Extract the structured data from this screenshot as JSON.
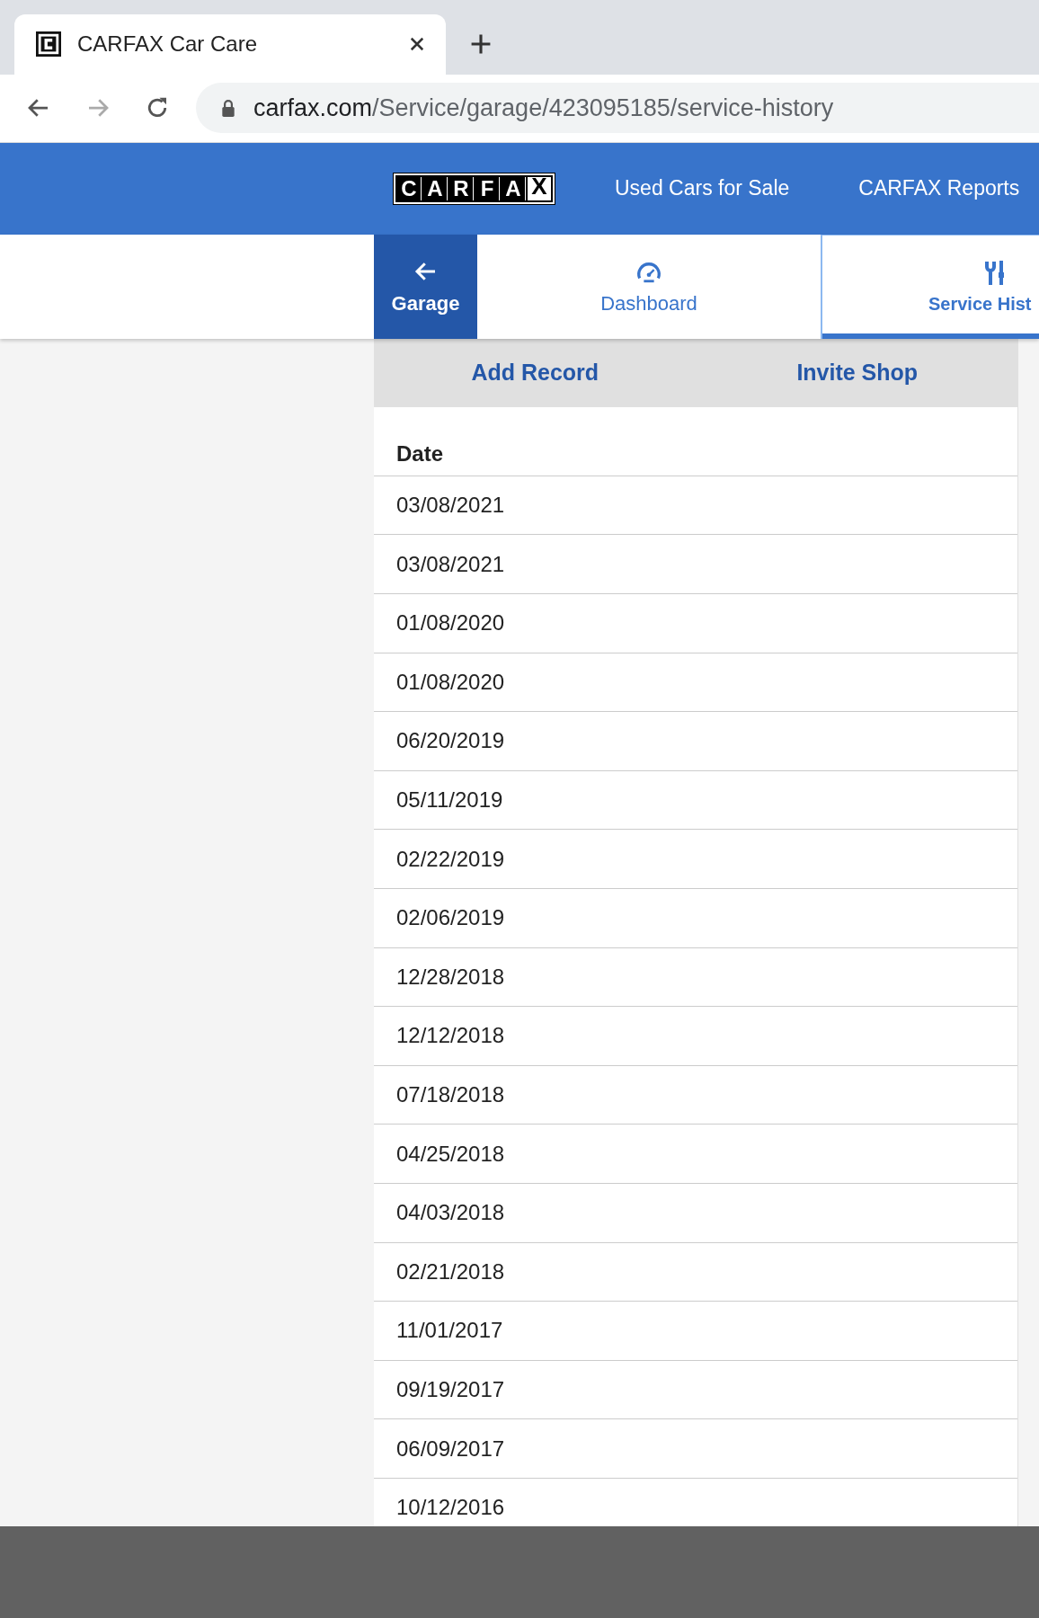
{
  "browser": {
    "tab_title": "CARFAX Car Care",
    "url_host": "carfax.com",
    "url_path": "/Service/garage/423095185/service-history"
  },
  "header": {
    "logo_letters": [
      "C",
      "A",
      "R",
      "F",
      "A",
      "X"
    ],
    "links": [
      "Used Cars for Sale",
      "CARFAX Reports"
    ]
  },
  "nav": [
    {
      "kind": "back",
      "label": "Garage",
      "selected": false
    },
    {
      "kind": "dashboard",
      "label": "Dashboard",
      "selected": false
    },
    {
      "kind": "service",
      "label": "Service Hist",
      "selected": true
    }
  ],
  "actions": [
    "Add Record",
    "Invite Shop"
  ],
  "table": {
    "columns": [
      "Date"
    ],
    "rows": [
      "03/08/2021",
      "03/08/2021",
      "01/08/2020",
      "01/08/2020",
      "06/20/2019",
      "05/11/2019",
      "02/22/2019",
      "02/06/2019",
      "12/28/2018",
      "12/12/2018",
      "07/18/2018",
      "04/25/2018",
      "04/03/2018",
      "02/21/2018",
      "11/01/2017",
      "09/19/2017",
      "06/09/2017",
      "10/12/2016"
    ]
  }
}
